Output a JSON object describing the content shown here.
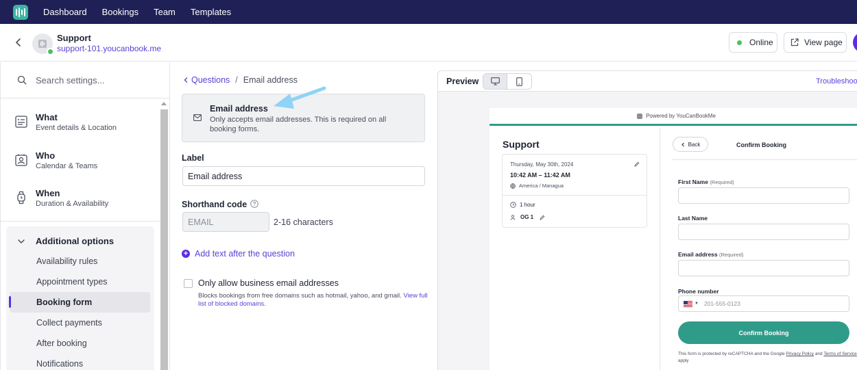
{
  "nav": {
    "items": [
      "Dashboard",
      "Bookings",
      "Team",
      "Templates"
    ]
  },
  "header": {
    "account_name": "Support",
    "account_url": "support-101.youcanbook.me",
    "online_label": "Online",
    "view_page_label": "View page"
  },
  "sidebar": {
    "search_placeholder": "Search settings...",
    "sections": [
      {
        "title": "What",
        "subtitle": "Event details & Location"
      },
      {
        "title": "Who",
        "subtitle": "Calendar & Teams"
      },
      {
        "title": "When",
        "subtitle": "Duration & Availability"
      }
    ],
    "additional": {
      "title": "Additional options",
      "items": [
        "Availability rules",
        "Appointment types",
        "Booking form",
        "Collect payments",
        "After booking",
        "Notifications"
      ],
      "active": "Booking form"
    }
  },
  "editor": {
    "breadcrumb_parent": "Questions",
    "breadcrumb_sep": "/",
    "breadcrumb_current": "Email address",
    "question_title": "Email address",
    "question_desc": "Only accepts email addresses. This is required on all booking forms.",
    "label_heading": "Label",
    "label_value": "Email address",
    "shorthand_heading": "Shorthand code",
    "shorthand_value": "EMAIL",
    "shorthand_hint": "2-16 characters",
    "add_text_label": "Add text after the question",
    "business_only_label": "Only allow business email addresses",
    "business_only_desc": "Blocks bookings from free domains such as hotmail, yahoo, and gmail.",
    "business_only_link": "View full list of blocked domains."
  },
  "preview": {
    "title": "Preview",
    "troubleshoot": "Troubleshoo",
    "powered_by": "Powered by YouCanBookMe",
    "page_title": "Support",
    "slot": {
      "date": "Thursday, May 30th, 2024",
      "time": "10:42 AM – 11:42 AM",
      "timezone": "America / Managua",
      "duration": "1 hour",
      "person": "OG 1"
    },
    "back_label": "Back",
    "confirm_heading": "Confirm Booking",
    "fields": {
      "first_name": "First Name",
      "last_name": "Last Name",
      "email": "Email address",
      "phone": "Phone number",
      "required": "(Required)",
      "phone_placeholder": "201-555-0123"
    },
    "confirm_button": "Confirm Booking",
    "legal_prefix": "This form is protected by reCAPTCHA and the Google",
    "legal_privacy": "Privacy Policy",
    "legal_and": "and",
    "legal_terms": "Terms of Service",
    "legal_suffix": "apply"
  }
}
